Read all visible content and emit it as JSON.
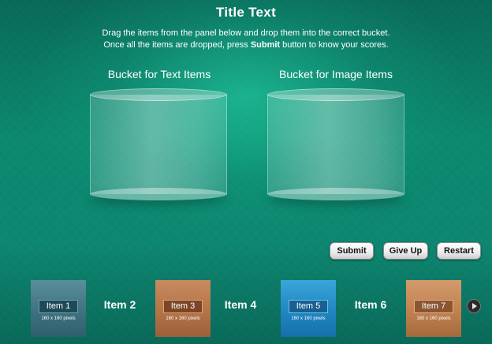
{
  "title": "Title Text",
  "instructions": {
    "line1": "Drag the items from the panel below and drop them into the correct bucket.",
    "line2_before": "Once all the items are dropped, press ",
    "line2_bold": "Submit",
    "line2_after": " button to know your scores."
  },
  "buckets": [
    {
      "label": "Bucket for Text Items"
    },
    {
      "label": "Bucket for Image Items"
    }
  ],
  "buttons": {
    "submit": "Submit",
    "give_up": "Give Up",
    "restart": "Restart"
  },
  "items": [
    {
      "label": "Item 1",
      "size": "160 x 160 pixels",
      "kind": "image"
    },
    {
      "label": "Item 2",
      "kind": "text"
    },
    {
      "label": "Item 3",
      "size": "160 x 160 pixels",
      "kind": "image"
    },
    {
      "label": "Item 4",
      "kind": "text"
    },
    {
      "label": "Item 5",
      "size": "160 x 160 pixels",
      "kind": "image"
    },
    {
      "label": "Item 6",
      "kind": "text"
    },
    {
      "label": "Item 7",
      "size": "160 x 160 pixels",
      "kind": "image"
    }
  ],
  "next_icon": "chevron-right-icon",
  "colors": {
    "background": "#0f8c74",
    "tile_slate": "#3e7280",
    "tile_copper": "#b47448",
    "tile_blue": "#1f86c2"
  }
}
